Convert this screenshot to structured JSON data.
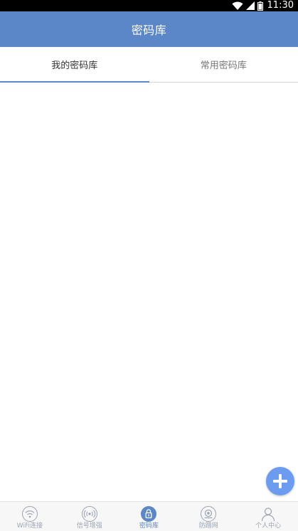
{
  "status_bar": {
    "time": "11:30",
    "icons": [
      "wifi-icon",
      "signal-icon",
      "battery-icon"
    ]
  },
  "header": {
    "title": "密码库"
  },
  "tabs": [
    {
      "label": "我的密码库",
      "active": true
    },
    {
      "label": "常用密码库",
      "active": false
    }
  ],
  "fab": {
    "icon": "plus-icon"
  },
  "bottom_nav": {
    "items": [
      {
        "label": "WiFi连接",
        "icon": "wifi-icon",
        "active": false
      },
      {
        "label": "信号增强",
        "icon": "signal-boost-icon",
        "active": false
      },
      {
        "label": "密码库",
        "icon": "lock-icon",
        "active": true
      },
      {
        "label": "防蹭网",
        "icon": "camera-icon",
        "active": false
      },
      {
        "label": "个人中心",
        "icon": "user-icon",
        "active": false
      }
    ]
  },
  "colors": {
    "primary": "#5b86c7",
    "fab": "#6b9cf0",
    "nav_label": "#9aa3b3"
  }
}
